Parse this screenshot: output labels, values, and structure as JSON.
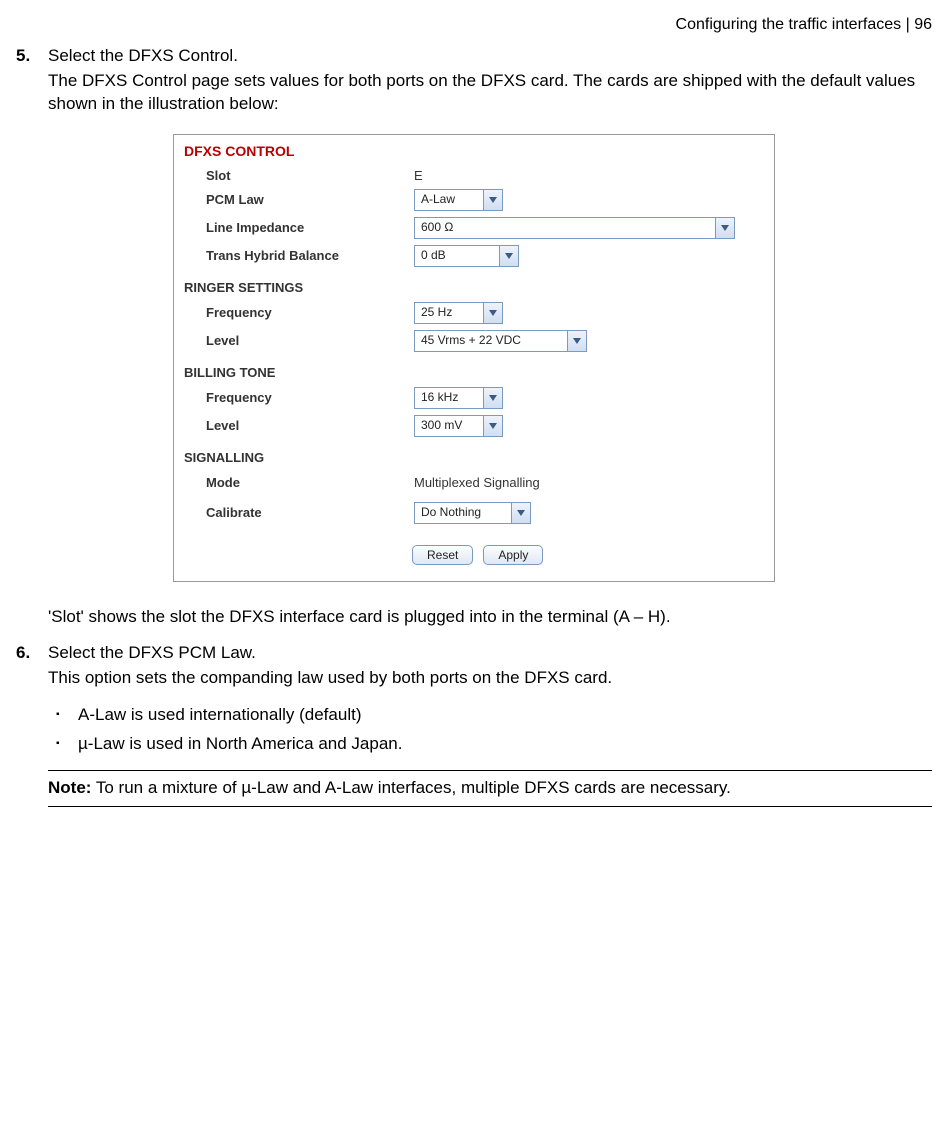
{
  "header": {
    "section": "Configuring the traffic interfaces",
    "separator": "  |  ",
    "page": "96"
  },
  "step5": {
    "num": "5.",
    "title": "Select the DFXS Control.",
    "para1": "The DFXS Control page sets values for both ports on the DFXS card. The cards are shipped with the default values shown in the illustration below:",
    "after_shot": "'Slot' shows the slot the DFXS interface card is plugged into in the terminal (A – H)."
  },
  "screenshot": {
    "title": "DFXS CONTROL",
    "rows": {
      "slot_label": "Slot",
      "slot_value": "E",
      "pcm_label": "PCM Law",
      "pcm_value": "A-Law",
      "imp_label": "Line Impedance",
      "imp_value": "600 Ω",
      "thb_label": "Trans Hybrid Balance",
      "thb_value": "0 dB"
    },
    "ringer": {
      "heading": "RINGER SETTINGS",
      "freq_label": "Frequency",
      "freq_value": "25 Hz",
      "level_label": "Level",
      "level_value": "45 Vrms + 22 VDC"
    },
    "billing": {
      "heading": "BILLING TONE",
      "freq_label": "Frequency",
      "freq_value": "16 kHz",
      "level_label": "Level",
      "level_value": "300 mV"
    },
    "signalling": {
      "heading": "SIGNALLING",
      "mode_label": "Mode",
      "mode_value": "Multiplexed Signalling",
      "cal_label": "Calibrate",
      "cal_value": "Do Nothing"
    },
    "buttons": {
      "reset": "Reset",
      "apply": "Apply"
    }
  },
  "step6": {
    "num": "6.",
    "title": "Select the DFXS PCM Law.",
    "para1": "This option sets the companding law used by both ports on the DFXS card.",
    "bullets": {
      "b1": "A-Law is used internationally (default)",
      "b2": "µ-Law is used in North America and Japan."
    }
  },
  "note": {
    "label": "Note:",
    "text": " To run a mixture of µ-Law and A-Law interfaces, multiple DFXS cards are necessary."
  }
}
